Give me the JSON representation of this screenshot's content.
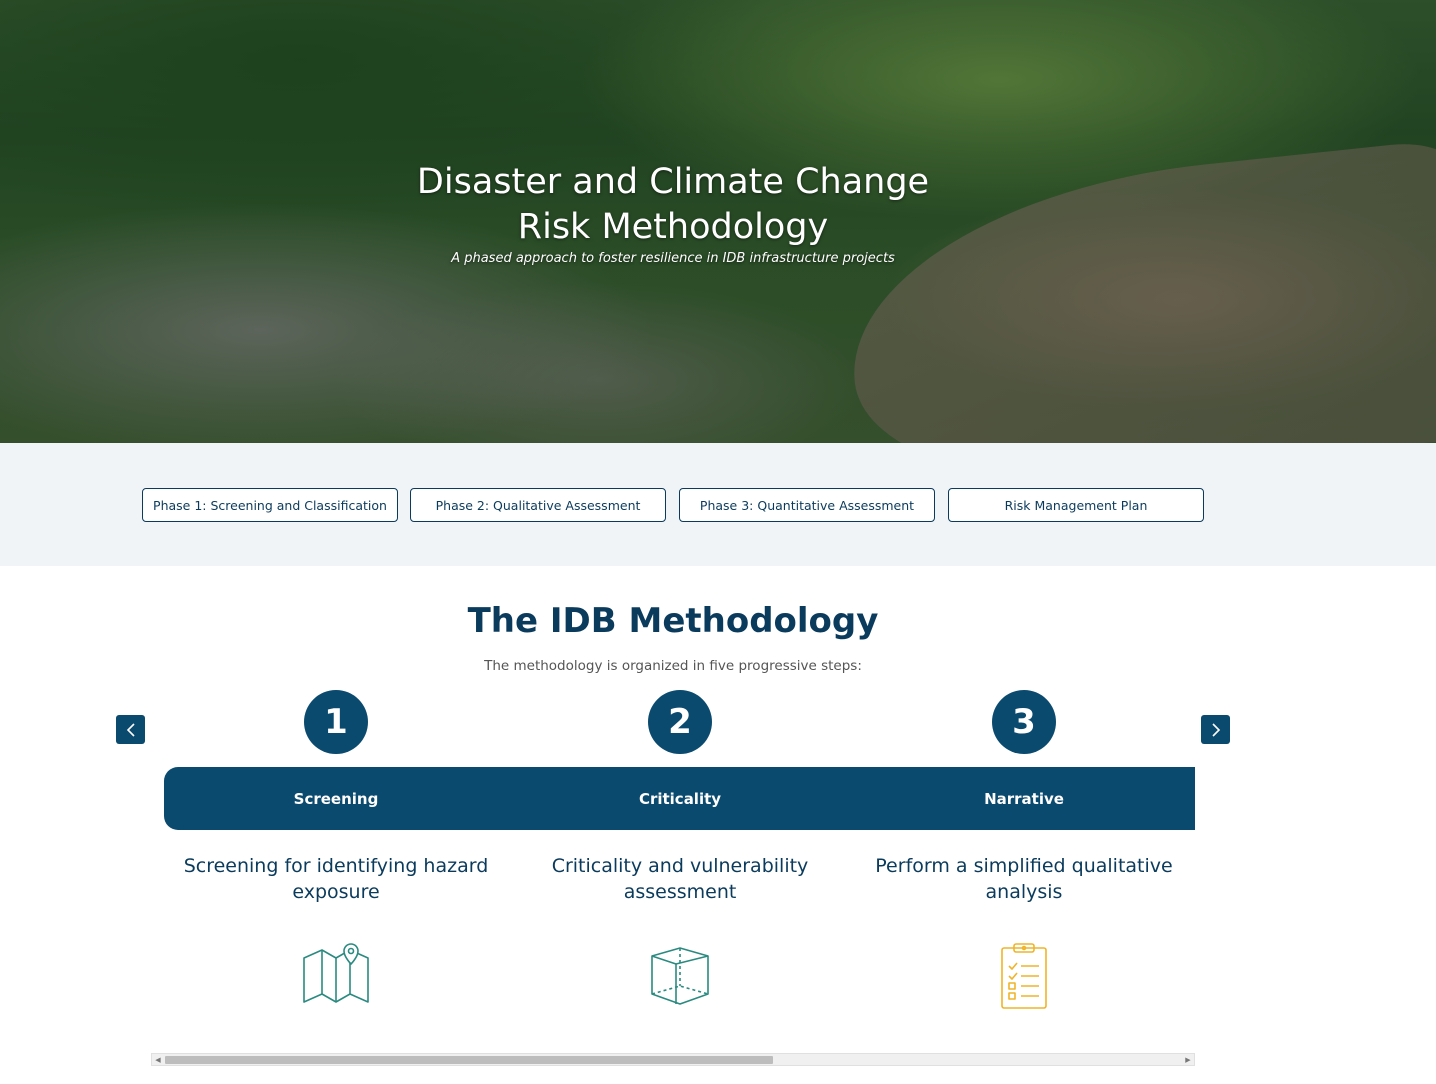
{
  "hero": {
    "title_line1": "Disaster and Climate Change",
    "title_line2": "Risk Methodology",
    "subtitle": "A phased approach to foster resilience in IDB infrastructure projects"
  },
  "phases": [
    {
      "label": "Phase 1: Screening and Classification"
    },
    {
      "label": "Phase 2: Qualitative Assessment"
    },
    {
      "label": "Phase 3: Quantitative Assessment"
    },
    {
      "label": "Risk Management Plan"
    }
  ],
  "methodology": {
    "title": "The IDB Methodology",
    "subtitle": "The methodology is organized in five progressive steps:",
    "steps": [
      {
        "number": "1",
        "label": "Screening",
        "description": "Screening for identifying hazard exposure",
        "icon": "map-pin-icon"
      },
      {
        "number": "2",
        "label": "Criticality",
        "description": "Criticality and vulnerability assessment",
        "icon": "cube-icon"
      },
      {
        "number": "3",
        "label": "Narrative",
        "description": "Perform a simplified qualitative analysis",
        "icon": "clipboard-checklist-icon"
      }
    ]
  },
  "colors": {
    "brand": "#0b4a6f",
    "teal_icon": "#2a8a80",
    "gold_icon": "#f0b429",
    "band_bg": "#f1f4f7"
  }
}
